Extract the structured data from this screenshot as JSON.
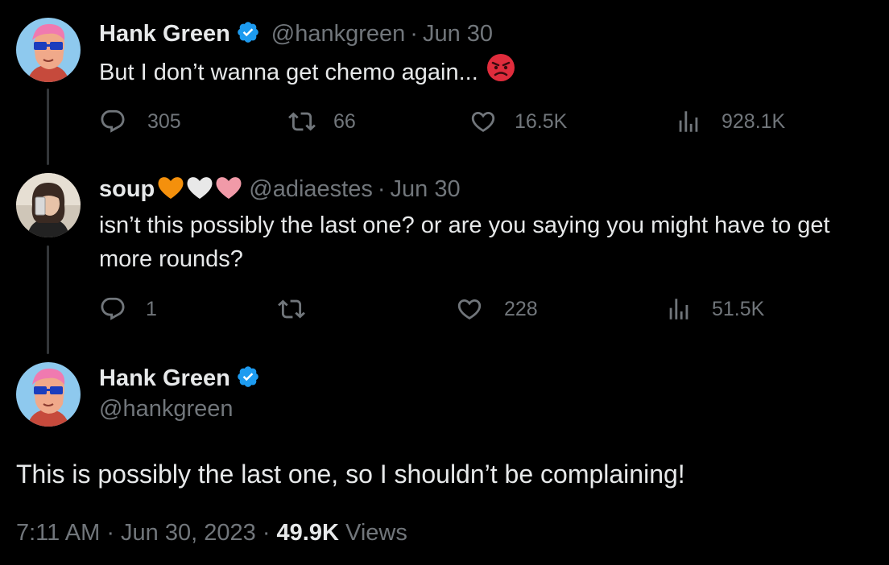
{
  "tweet1": {
    "name": "Hank Green",
    "handle": "@hankgreen",
    "sep": "·",
    "date": "Jun 30",
    "text": "But I don’t wanna get chemo again...",
    "emoji": "angry-face",
    "replies": "305",
    "retweets": "66",
    "likes": "16.5K",
    "views": "928.1K"
  },
  "tweet2": {
    "name": "soup",
    "name_emojis": [
      "orange-heart",
      "white-heart",
      "pink-heart"
    ],
    "handle": "@adiaestes",
    "sep": "·",
    "date": "Jun 30",
    "text": "isn’t this possibly the last one? or are you saying you might have to get more rounds?",
    "replies": "1",
    "retweets": "",
    "likes": "228",
    "views": "51.5K"
  },
  "tweet3": {
    "name": "Hank Green",
    "handle": "@hankgreen",
    "text": "This is possibly the last one, so I shouldn’t be complaining!",
    "time": "7:11 AM",
    "sep1": "·",
    "date": "Jun 30, 2023",
    "sep2": "·",
    "views_count": "49.9K",
    "views_label": "Views"
  },
  "colors": {
    "background": "#000000",
    "text_primary": "#e7e9ea",
    "text_secondary": "#71767b",
    "verified_blue": "#1d9bf0",
    "thread_line": "#333639"
  }
}
